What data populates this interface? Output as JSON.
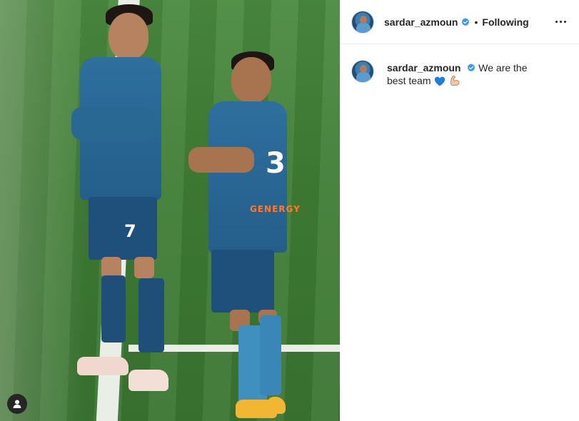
{
  "post": {
    "author": {
      "username": "sardar_azmoun",
      "verified": true,
      "follow_separator": "•",
      "follow_status": "Following"
    },
    "caption": {
      "username": "sardar_azmoun",
      "text": "We are the best team",
      "emojis": [
        "blue-heart",
        "flexed-biceps"
      ]
    }
  },
  "photo": {
    "player_numbers": [
      "7",
      "3"
    ],
    "sponsor_text": "GENERGY"
  },
  "colors": {
    "text": "#262626",
    "verified_blue": "#3897f0",
    "divider": "#efefef",
    "kit_blue": "#2e6f9e",
    "pitch_green": "#3f7d35"
  },
  "icons": {
    "more": "more-horizontal-icon",
    "verified": "verified-badge-icon",
    "tagged": "user-tag-icon"
  }
}
